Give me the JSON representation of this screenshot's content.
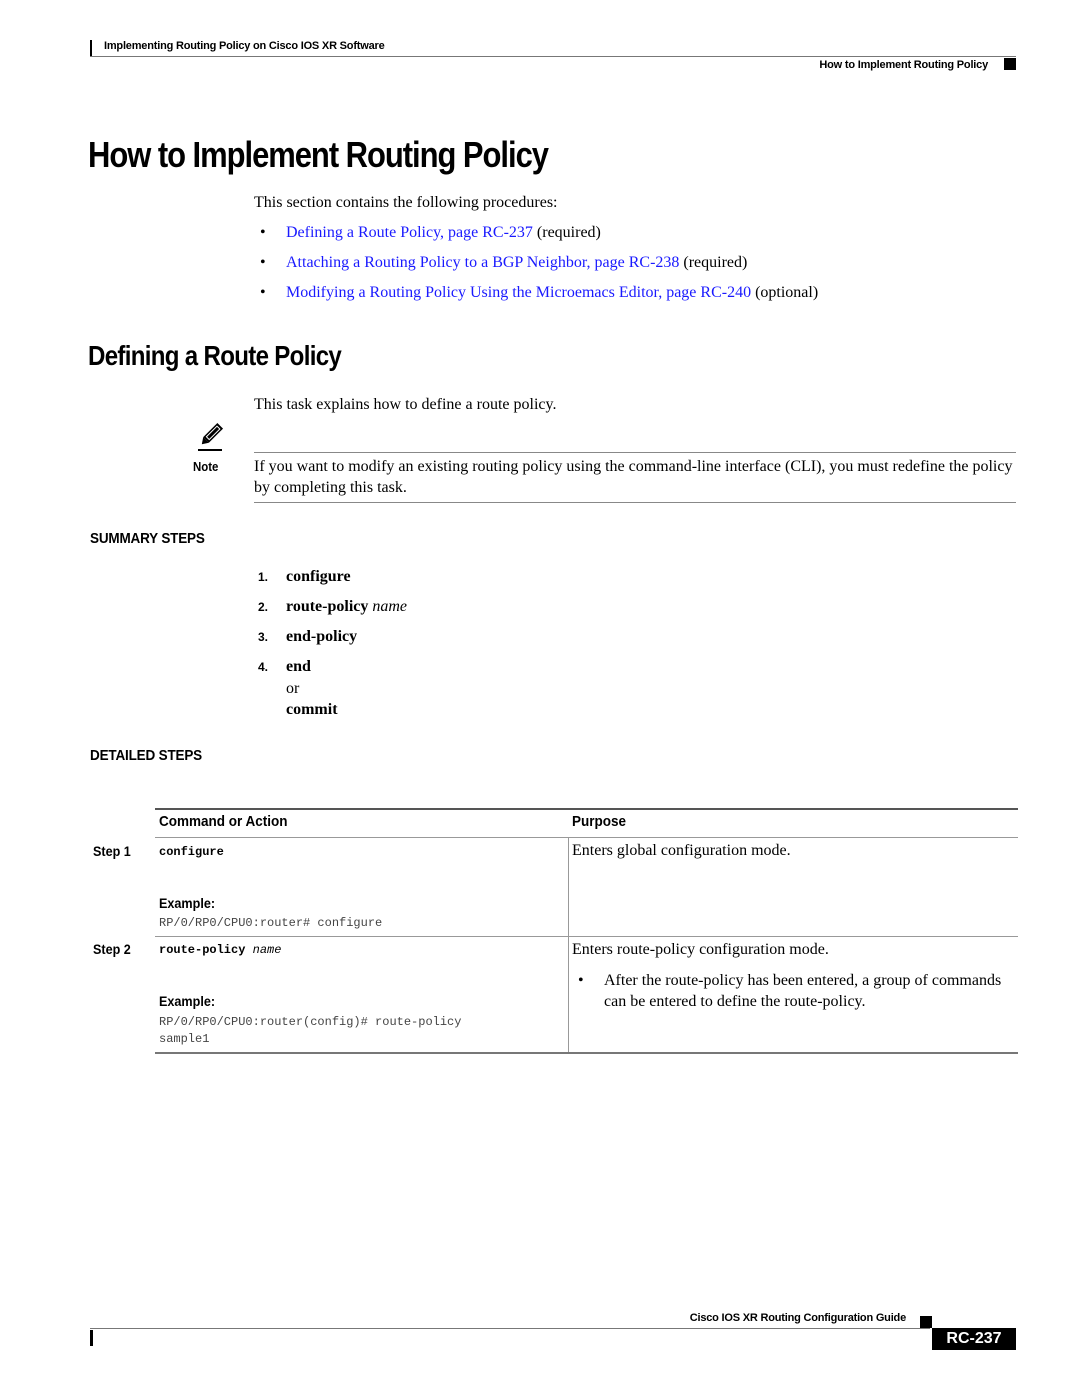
{
  "header": {
    "doc_title": "Implementing Routing Policy on Cisco IOS XR Software",
    "section_title": "How to Implement Routing Policy"
  },
  "main_heading": "How to Implement Routing Policy",
  "intro": "This section contains the following procedures:",
  "procedures": [
    {
      "link": "Defining a Route Policy, page RC-237",
      "suffix": " (required)"
    },
    {
      "link": "Attaching a Routing Policy to a BGP Neighbor, page RC-238",
      "suffix": " (required)"
    },
    {
      "link": "Modifying a Routing Policy Using the Microemacs Editor, page RC-240",
      "suffix": " (optional)"
    }
  ],
  "bullet": "•",
  "sub_heading": "Defining a Route Policy",
  "task_text": "This task explains how to define a route policy.",
  "note": {
    "label": "Note",
    "text": "If you want to modify an existing routing policy using the command-line interface (CLI), you must redefine the policy by completing this task."
  },
  "summary": {
    "heading": "SUMMARY STEPS",
    "steps": [
      {
        "num": "1.",
        "cmd": "configure",
        "arg": ""
      },
      {
        "num": "2.",
        "cmd": "route-policy",
        "arg": "name"
      },
      {
        "num": "3.",
        "cmd": "end-policy",
        "arg": ""
      },
      {
        "num": "4.",
        "cmd": "end",
        "arg": ""
      }
    ],
    "or_text": "or",
    "alt_cmd": "commit"
  },
  "detailed": {
    "heading": "DETAILED STEPS",
    "columns": [
      "Command or Action",
      "Purpose"
    ],
    "rows": [
      {
        "step": "Step 1",
        "cmd": "configure",
        "arg": "",
        "example_label": "Example:",
        "example_lines": [
          "RP/0/RP0/CPU0:router# configure"
        ],
        "purpose": "Enters global configuration mode.",
        "purpose_bullets": []
      },
      {
        "step": "Step 2",
        "cmd": "route-policy",
        "arg": "name",
        "example_label": "Example:",
        "example_lines": [
          "RP/0/RP0/CPU0:router(config)# route-policy",
          "sample1"
        ],
        "purpose": "Enters route-policy configuration mode.",
        "purpose_bullets": [
          "After the route-policy has been entered, a group of commands can be entered to define the route-policy."
        ]
      }
    ]
  },
  "footer": {
    "guide_title": "Cisco IOS XR Routing Configuration Guide",
    "page_number": "RC-237"
  }
}
